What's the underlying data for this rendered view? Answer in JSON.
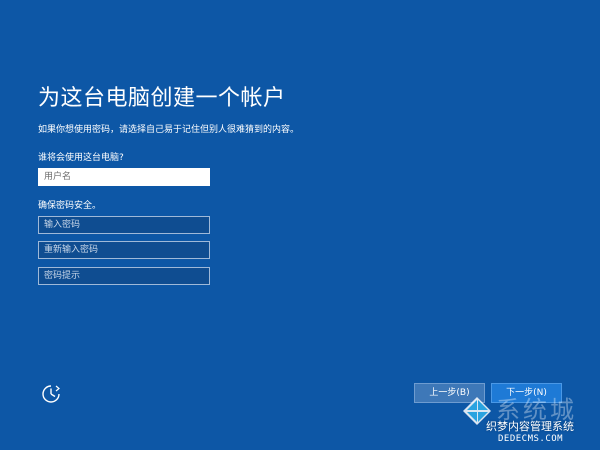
{
  "page": {
    "title": "为这台电脑创建一个帐户",
    "subtitle": "如果你想使用密码，请选择自己易于记住但别人很难猜到的内容。"
  },
  "user_section": {
    "label": "谁将会使用这台电脑?",
    "username_placeholder": "用户名",
    "username_value": ""
  },
  "password_section": {
    "label": "确保密码安全。",
    "password_placeholder": "输入密码",
    "confirm_placeholder": "重新输入密码",
    "hint_placeholder": "密码提示"
  },
  "footer": {
    "ease_of_access_icon": "ease-of-access-icon",
    "back_label": "上一步(B)",
    "next_label": "下一步(N)"
  },
  "watermark": {
    "logo_icon": "windows-logo-icon",
    "big_text": "系统城",
    "cn_text": "织梦内容管理系统",
    "url_text": "DEDECMS.COM"
  },
  "colors": {
    "background": "#0d57a6",
    "next_button": "#1e7ad6",
    "back_button": "#3e78b8"
  }
}
